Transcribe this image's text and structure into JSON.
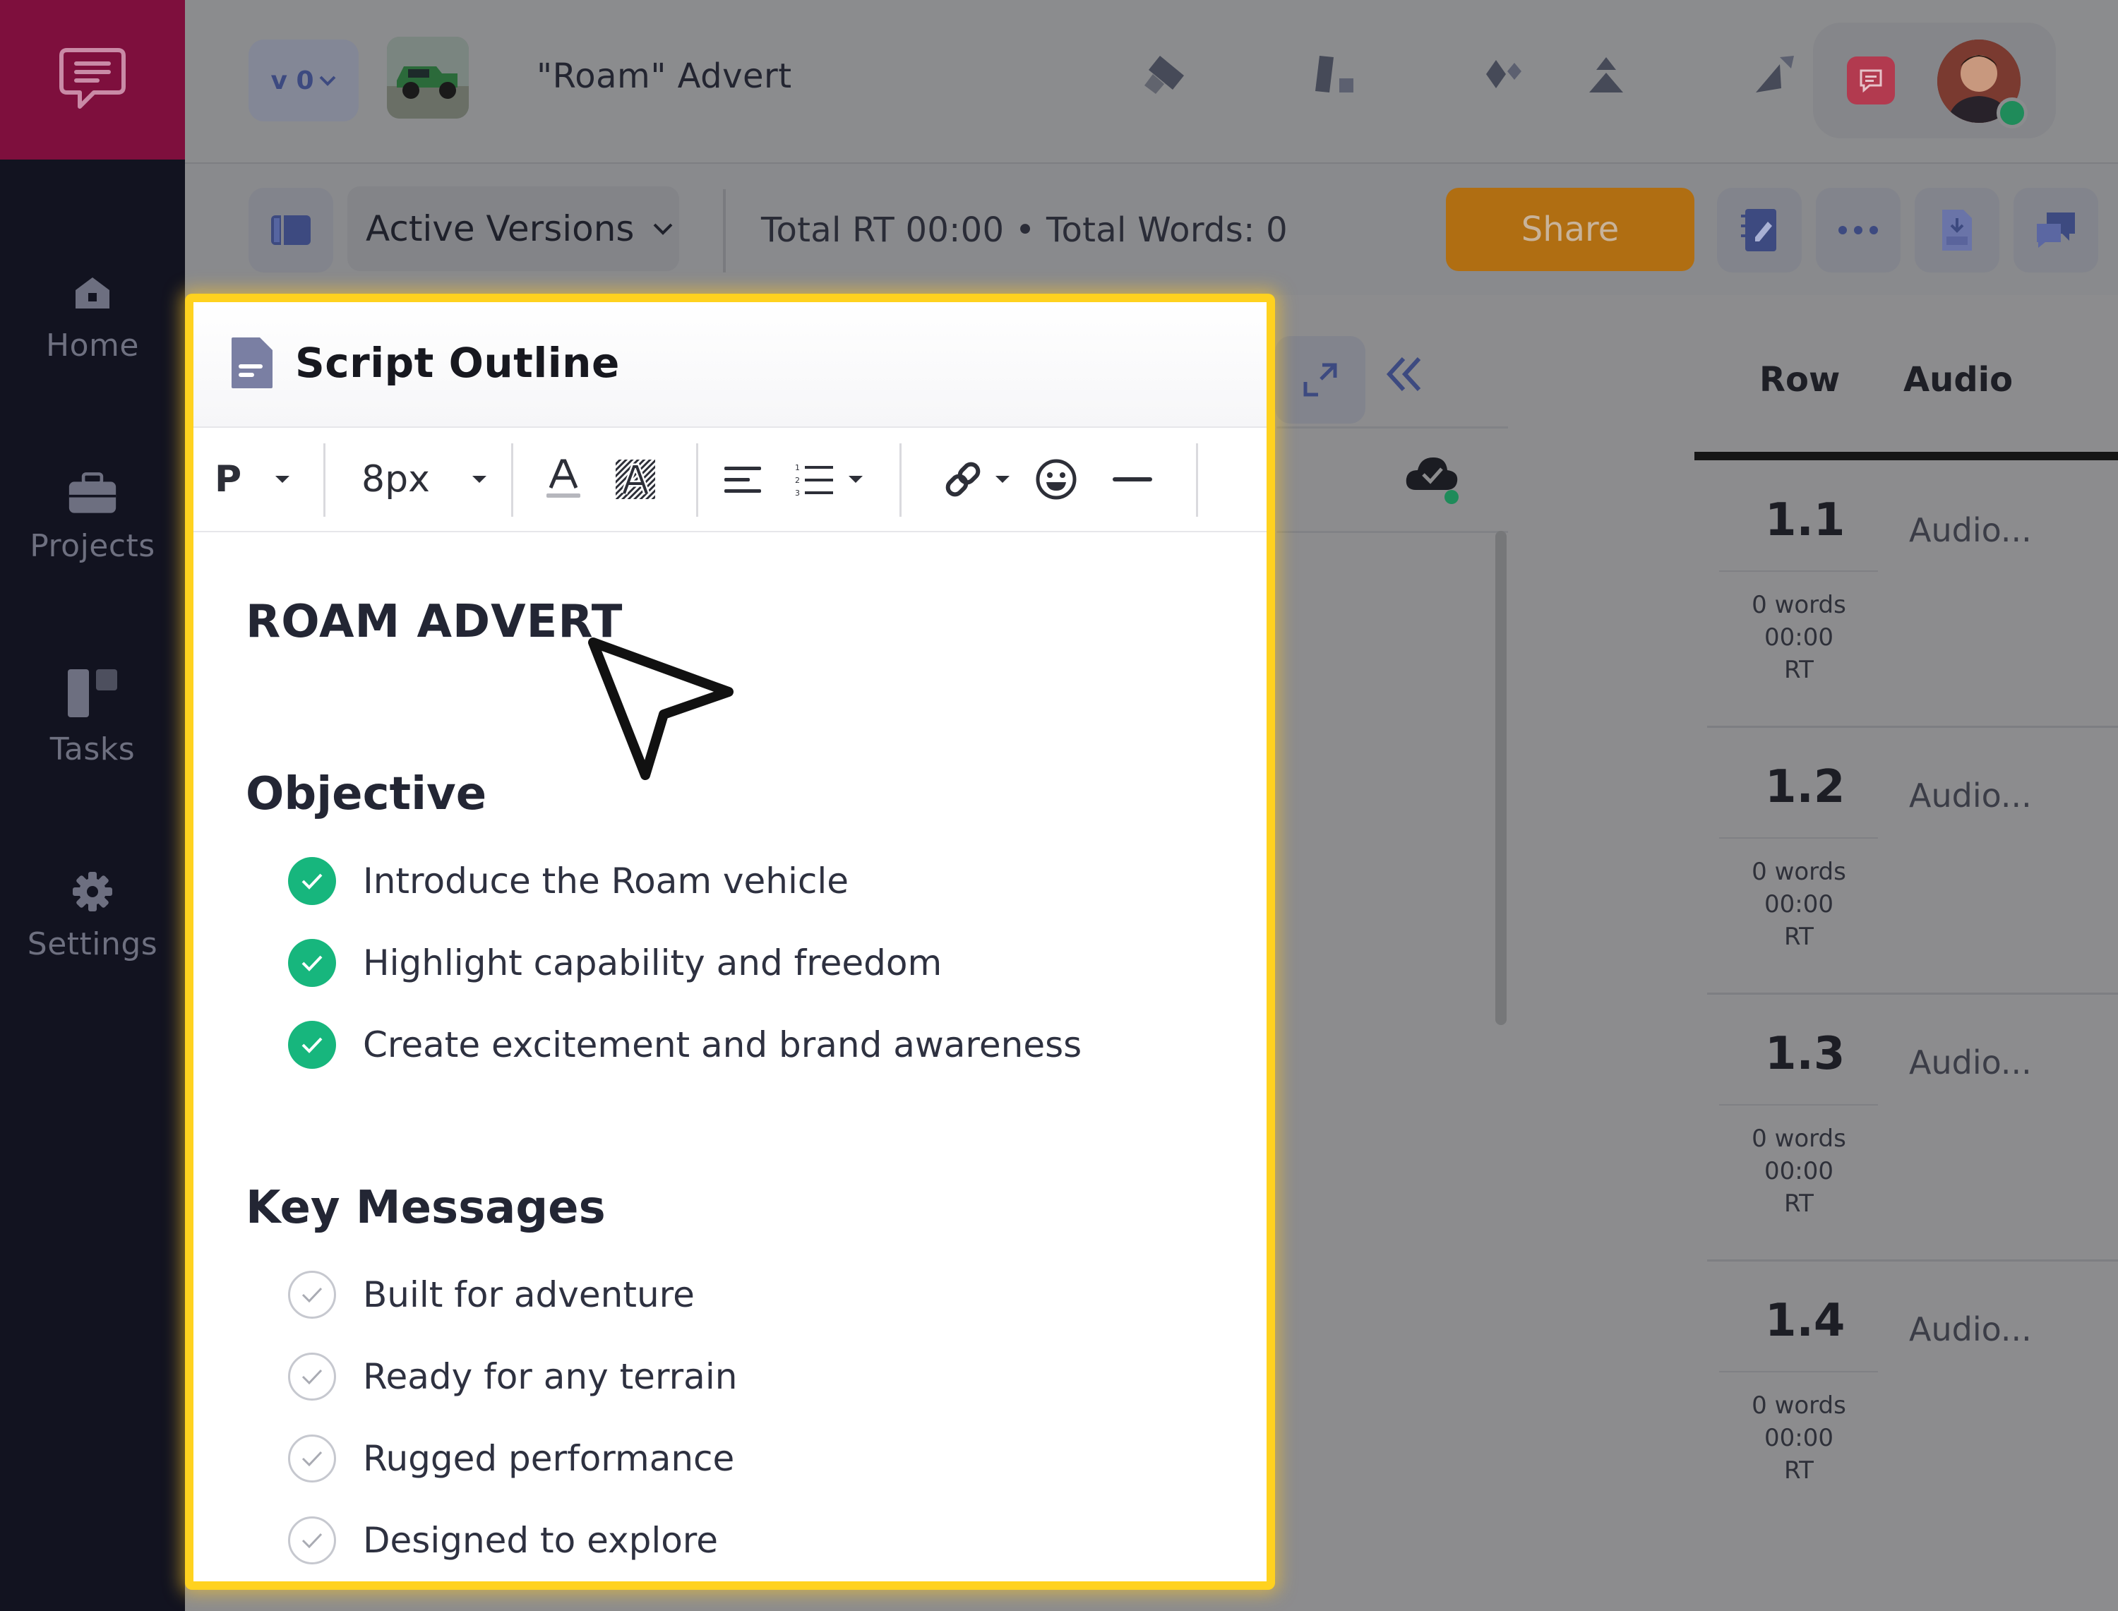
{
  "sidebar": {
    "items": [
      {
        "label": "Home",
        "icon": "home-icon"
      },
      {
        "label": "Projects",
        "icon": "briefcase-icon"
      },
      {
        "label": "Tasks",
        "icon": "board-icon"
      },
      {
        "label": "Settings",
        "icon": "gear-icon"
      }
    ]
  },
  "header": {
    "version_label": "v 0",
    "project_title": "\"Roam\" Advert"
  },
  "toolbar": {
    "active_versions_label": "Active Versions",
    "totals": "Total RT 00:00 • Total Words: 0",
    "share_label": "Share"
  },
  "outline": {
    "title": "Script Outline",
    "editor": {
      "paragraph_style": "P",
      "font_size": "8px"
    },
    "doc_title": "ROAM ADVERT",
    "objective_heading": "Objective",
    "objectives": [
      "Introduce the Roam vehicle",
      "Highlight capability and freedom",
      "Create excitement and brand awareness"
    ],
    "key_messages_heading": "Key Messages",
    "key_messages": [
      "Built for adventure",
      "Ready for any terrain",
      "Rugged performance",
      "Designed to explore"
    ]
  },
  "script_table": {
    "columns": [
      "Row",
      "Audio"
    ],
    "rows": [
      {
        "num": "1.1",
        "audio": "Audio...",
        "words": "0 words",
        "rt": "00:00 RT"
      },
      {
        "num": "1.2",
        "audio": "Audio...",
        "words": "0 words",
        "rt": "00:00 RT"
      },
      {
        "num": "1.3",
        "audio": "Audio...",
        "words": "0 words",
        "rt": "00:00 RT"
      },
      {
        "num": "1.4",
        "audio": "Audio...",
        "words": "0 words",
        "rt": "00:00 RT"
      }
    ]
  },
  "colors": {
    "brand": "#c2185b",
    "share": "#f08c00",
    "check_green": "#17b67d",
    "highlight": "#ffd21f"
  }
}
